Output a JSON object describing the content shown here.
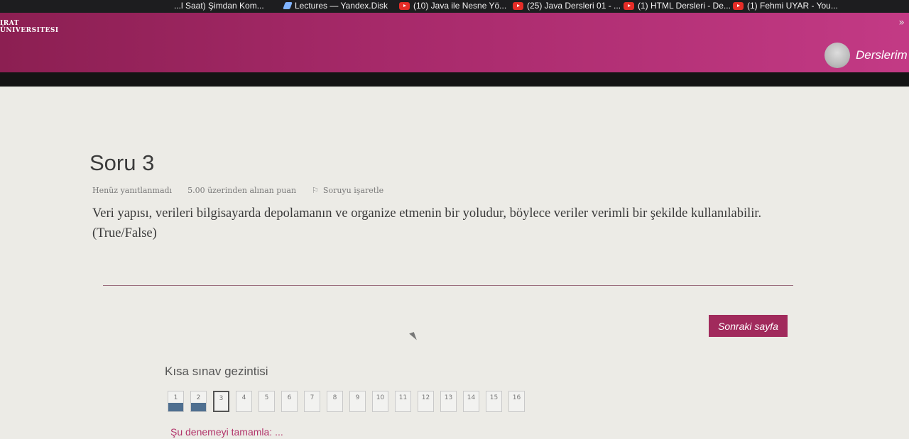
{
  "bookmarks": [
    {
      "label": "...l Saat) Şimdan Kom...",
      "icon": "bookmark-icon"
    },
    {
      "label": "Lectures — Yandex.Disk",
      "icon": "yandex-disk-icon"
    },
    {
      "label": "(10) Java ile Nesne Yö...",
      "icon": "youtube-icon"
    },
    {
      "label": "(25) Java Dersleri 01 - ...",
      "icon": "youtube-icon"
    },
    {
      "label": "(1) HTML Dersleri - De...",
      "icon": "youtube-icon"
    },
    {
      "label": "(1) Fehmi UYAR - You...",
      "icon": "youtube-icon"
    }
  ],
  "header": {
    "logo_line1": "IRAT",
    "logo_line2": "ÜNIVERSITESI",
    "nav_link": "Derslerim",
    "accent": "#a82a6b"
  },
  "question": {
    "title": "Soru 3",
    "status": "Henüz yanıtlanmadı",
    "points": "5.00 üzerinden alınan puan",
    "flag_label": "Soruyu işaretle",
    "text": "Veri yapısı, verileri bilgisayarda depolamanın ve organize etmenin bir yoludur, böylece veriler verimli bir şekilde kullanılabilir.(True/False)"
  },
  "next_button": "Sonraki sayfa",
  "quiz_nav": {
    "title": "Kısa sınav gezintisi",
    "questions": [
      {
        "num": "1",
        "state": "answered"
      },
      {
        "num": "2",
        "state": "answered"
      },
      {
        "num": "3",
        "state": "current"
      },
      {
        "num": "4",
        "state": "unanswered"
      },
      {
        "num": "5",
        "state": "unanswered"
      },
      {
        "num": "6",
        "state": "unanswered"
      },
      {
        "num": "7",
        "state": "unanswered"
      },
      {
        "num": "8",
        "state": "unanswered"
      },
      {
        "num": "9",
        "state": "unanswered"
      },
      {
        "num": "10",
        "state": "unanswered"
      },
      {
        "num": "11",
        "state": "unanswered"
      },
      {
        "num": "12",
        "state": "unanswered"
      },
      {
        "num": "13",
        "state": "unanswered"
      },
      {
        "num": "14",
        "state": "unanswered"
      },
      {
        "num": "15",
        "state": "unanswered"
      },
      {
        "num": "16",
        "state": "unanswered"
      }
    ],
    "finish_link": "Şu denemeyi tamamla: ..."
  }
}
